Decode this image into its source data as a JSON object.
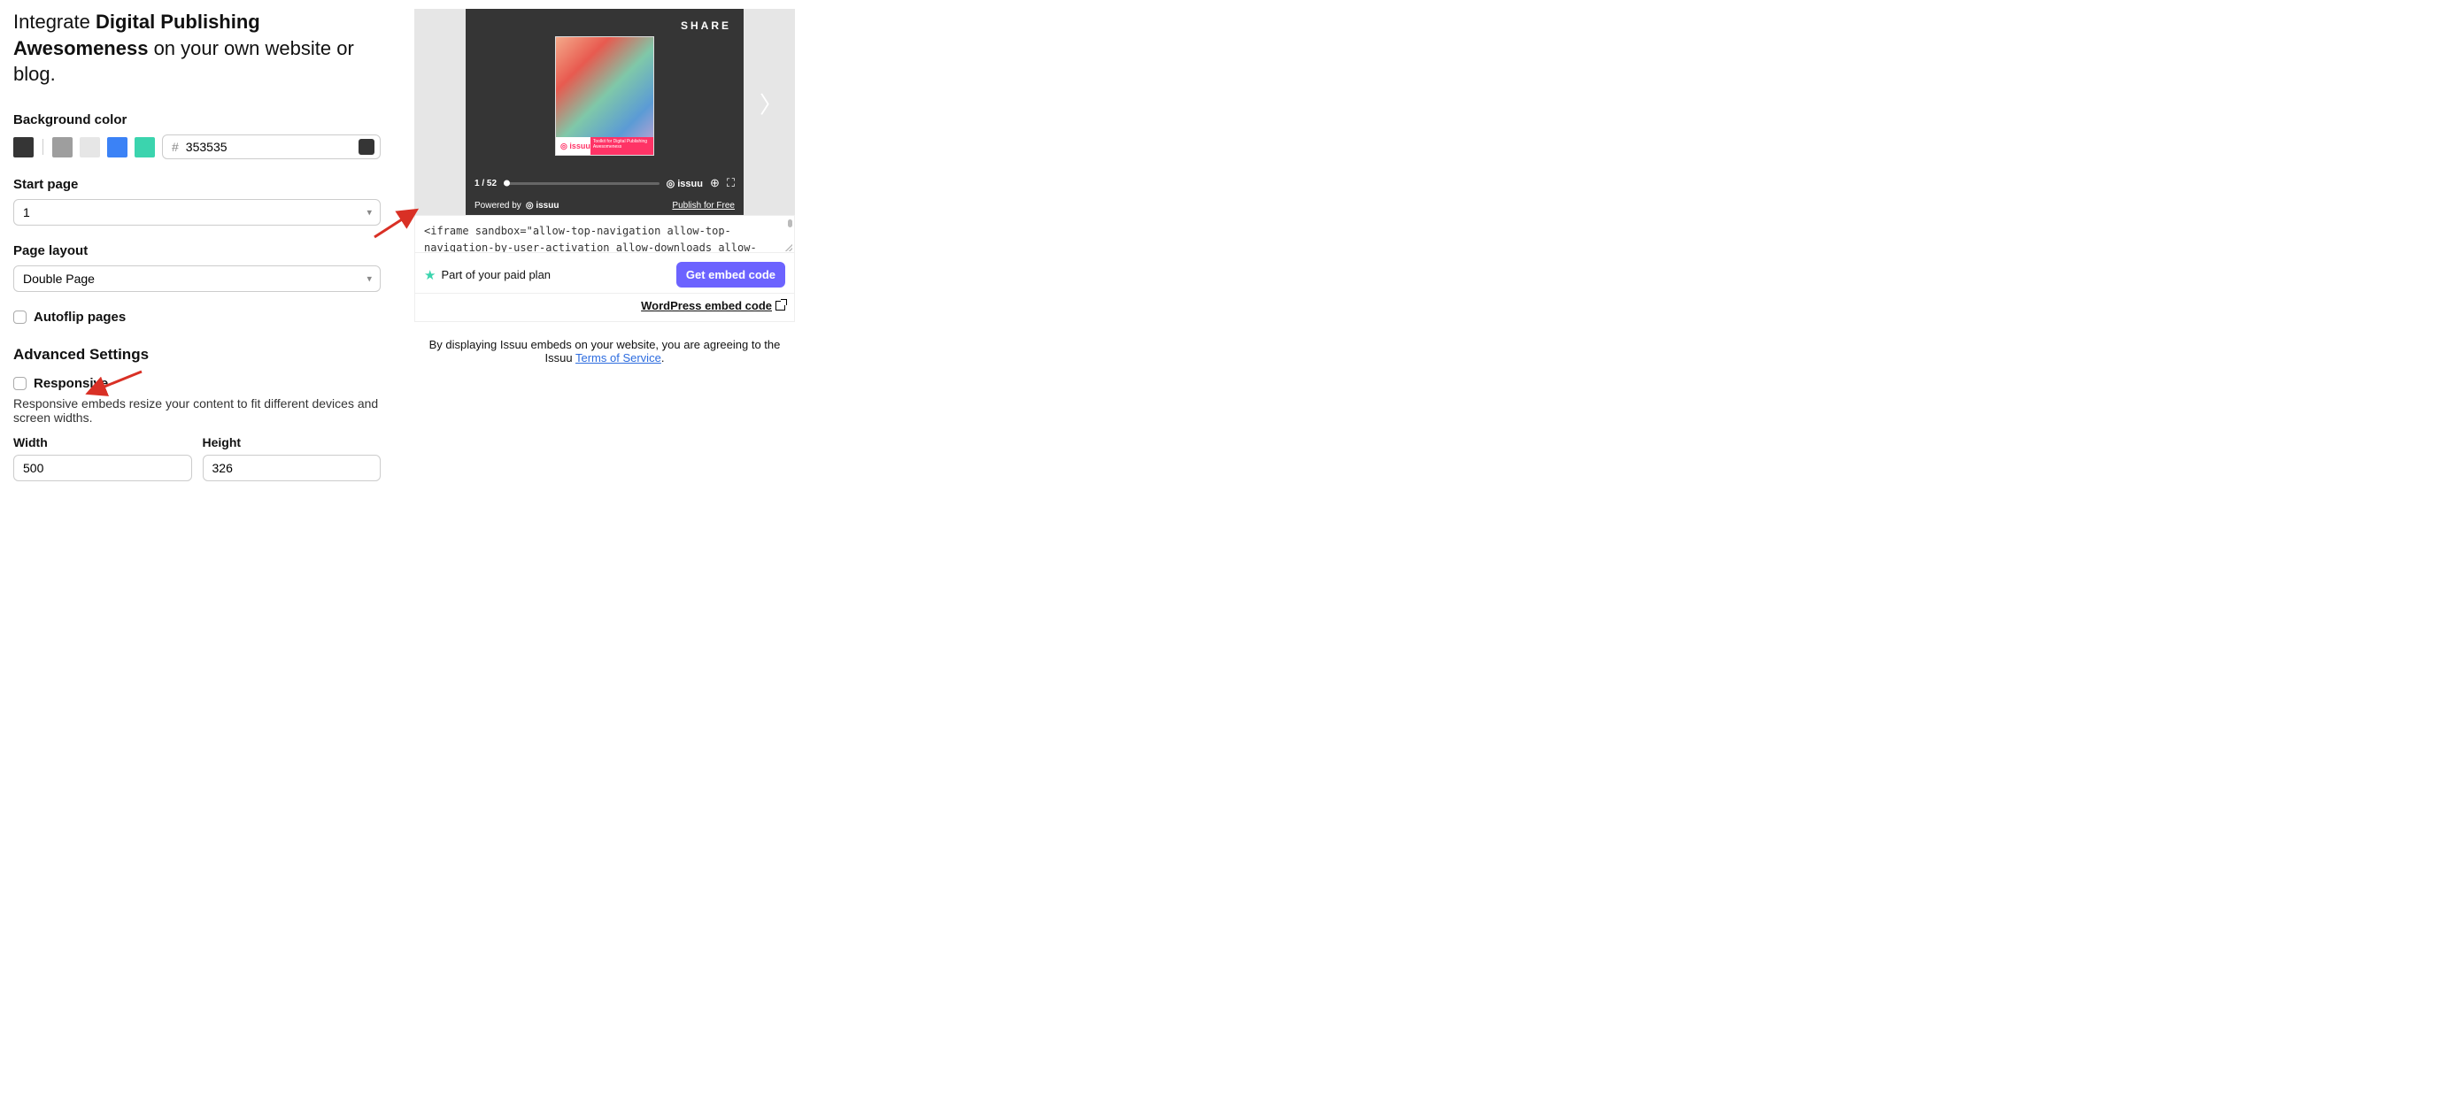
{
  "title_prefix": "Integrate ",
  "title_bold": "Digital Publishing Awesomeness",
  "title_suffix": " on your own website or blog.",
  "bg": {
    "label": "Background color",
    "swatches": [
      "#353535",
      "#9e9e9e",
      "#e6e6e6",
      "#3b82f6",
      "#3bd4ae"
    ],
    "hex_prefix": "#",
    "hex_value": "353535",
    "preview_color": "#353535"
  },
  "start_page": {
    "label": "Start page",
    "value": "1"
  },
  "layout": {
    "label": "Page layout",
    "value": "Double Page"
  },
  "autoflip": {
    "label": "Autoflip pages"
  },
  "advanced": {
    "heading": "Advanced Settings",
    "responsive_label": "Responsive",
    "responsive_desc": "Responsive embeds resize your content to fit different devices and screen widths.",
    "width_label": "Width",
    "width_value": "500",
    "height_label": "Height",
    "height_value": "326"
  },
  "preview": {
    "share": "SHARE",
    "pager": "1 / 52",
    "brand": "◎ issuu",
    "cover_brand": "◎ issuu",
    "cover_tag": "Toolkit for Digital Publishing Awesomeness",
    "powered": "Powered by",
    "powered_brand": "◎ issuu",
    "publish_free": "Publish for Free"
  },
  "code": "<iframe sandbox=\"allow-top-navigation allow-top-navigation-by-user-activation allow-downloads allow-scripts allow-same-origin allow-popups allow-modals allow-popups-to-escape-sandbox\" allowfullscreen=\"true\"",
  "actions": {
    "plan_text": "Part of your paid plan",
    "get_embed": "Get embed code",
    "wp_link": "WordPress embed code"
  },
  "tos": {
    "text": "By displaying Issuu embeds on your website, you are agreeing to the Issuu ",
    "link": "Terms of Service",
    "suffix": "."
  }
}
